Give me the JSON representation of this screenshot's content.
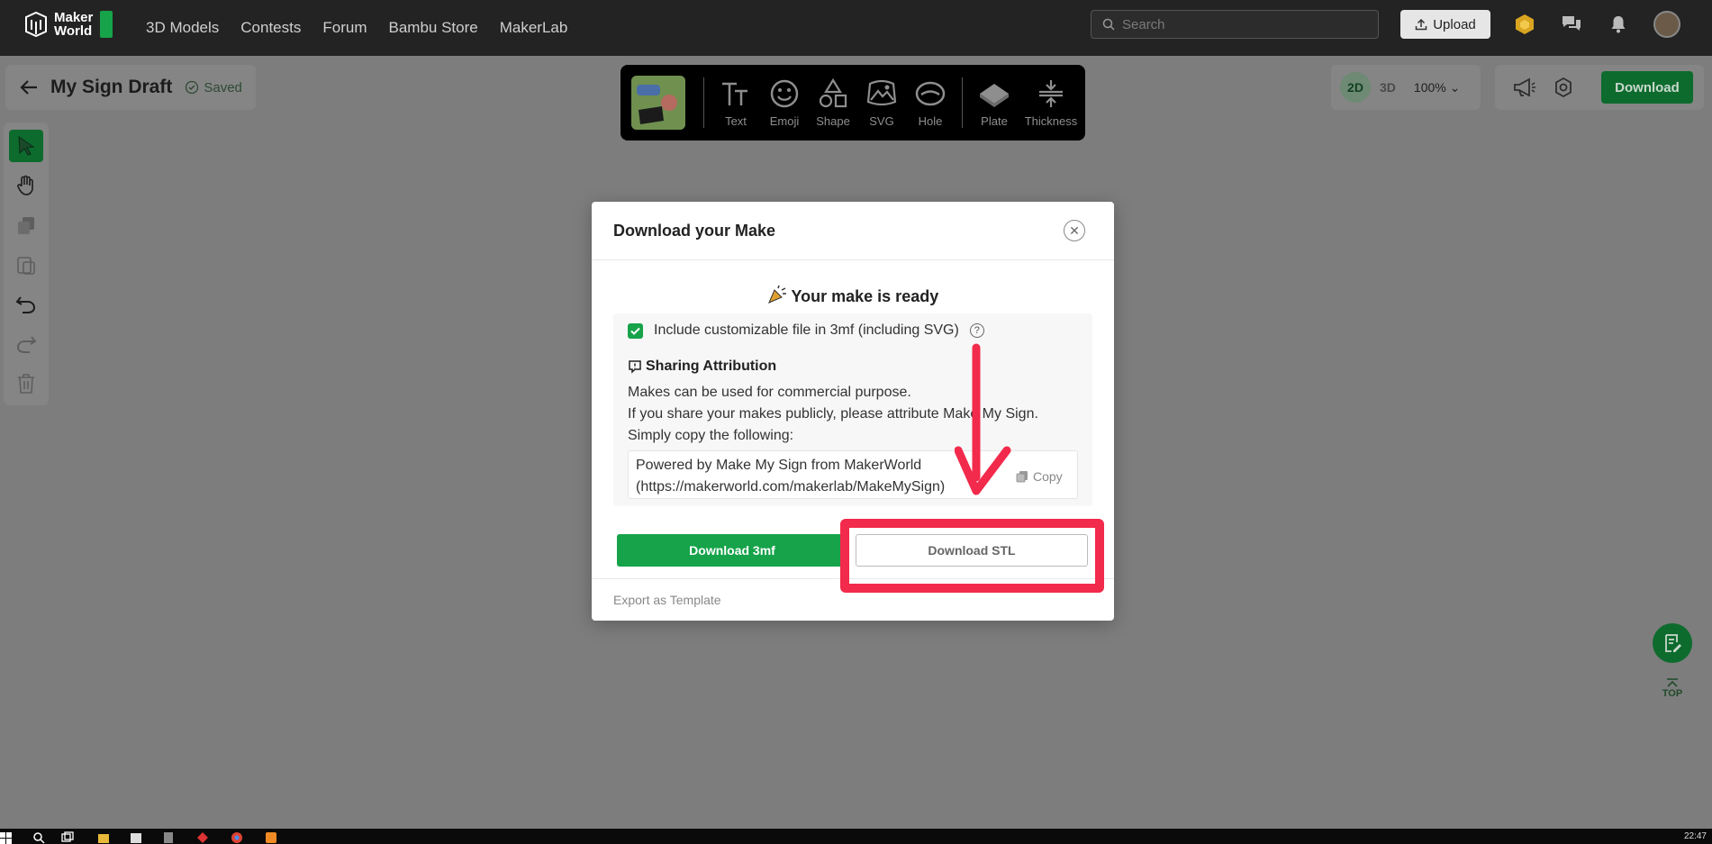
{
  "nav": {
    "logo_line1": "Maker",
    "logo_line2": "World",
    "links": [
      "3D Models",
      "Contests",
      "Forum",
      "Bambu Store",
      "MakerLab"
    ],
    "search_placeholder": "Search",
    "upload_label": "Upload"
  },
  "editor": {
    "title": "My Sign Draft",
    "saved_label": "Saved",
    "toolbar": [
      {
        "label": "Text",
        "icon": "text-icon"
      },
      {
        "label": "Emoji",
        "icon": "emoji-icon"
      },
      {
        "label": "Shape",
        "icon": "shape-icon"
      },
      {
        "label": "SVG",
        "icon": "svg-icon"
      },
      {
        "label": "Hole",
        "icon": "hole-icon"
      },
      {
        "label": "Plate",
        "icon": "plate-icon"
      },
      {
        "label": "Thickness",
        "icon": "thickness-icon"
      }
    ],
    "view_2d": "2D",
    "view_3d": "3D",
    "zoom": "100%",
    "download_label": "Download",
    "top_label": "TOP"
  },
  "modal": {
    "title": "Download your Make",
    "ready_text": "Your make is ready",
    "checkbox_label": "Include customizable file in 3mf (including SVG)",
    "checkbox_checked": true,
    "attribution_heading": "Sharing Attribution",
    "attribution_lines": [
      "Makes can be used for commercial purpose.",
      "If you share your makes publicly, please attribute Make My Sign.",
      "Simply copy the following:"
    ],
    "copy_text_line1": "Powered by Make My Sign from MakerWorld",
    "copy_text_line2": "(https://makerworld.com/makerlab/MakeMySign)",
    "copy_label": "Copy",
    "download_3mf_label": "Download 3mf",
    "download_stl_label": "Download STL",
    "export_template_label": "Export as Template"
  },
  "taskbar": {
    "clock": "22:47"
  },
  "colors": {
    "accent_green": "#16a34a",
    "highlight_red": "#f22a4b"
  }
}
